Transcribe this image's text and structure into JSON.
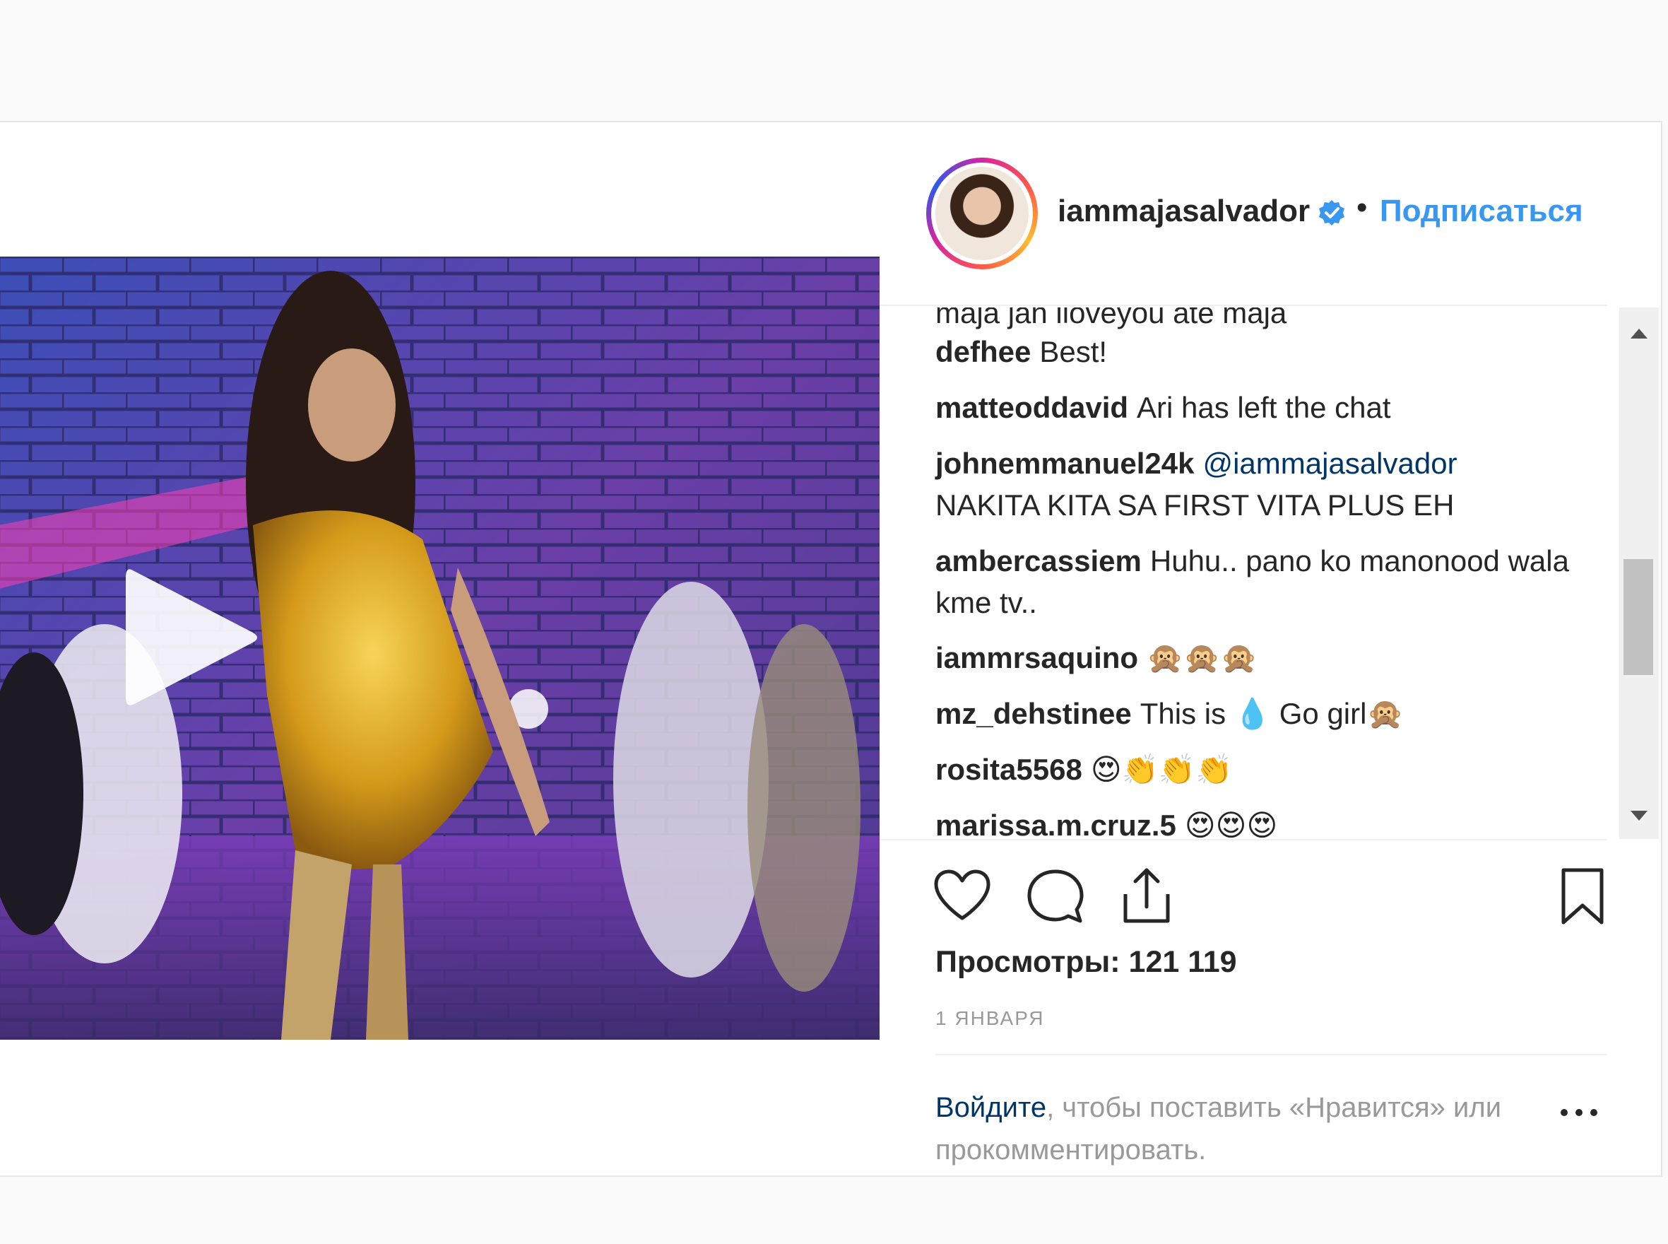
{
  "post": {
    "username": "iammajasalvador",
    "verified_icon": "verified-badge-icon",
    "separator": "•",
    "follow_label": "Подписаться",
    "comments": [
      {
        "user": "",
        "text": "maja jan iloveyou ate maja"
      },
      {
        "user": "defhee",
        "text": "Best!"
      },
      {
        "user": "matteoddavid",
        "text": "Ari has left the chat"
      },
      {
        "user": "johnemmanuel24k",
        "mention": "@iammajasalvador",
        "text": "NAKITA KITA SA FIRST VITA PLUS EH"
      },
      {
        "user": "ambercassiem",
        "text": "Huhu.. pano ko manonood wala kme tv.."
      },
      {
        "user": "iammrsaquino",
        "text": "🙊🙊🙊"
      },
      {
        "user": "mz_dehstinee",
        "text": "This is 💧 Go girl🙊"
      },
      {
        "user": "rosita5568",
        "text": "😍👏👏👏"
      },
      {
        "user": "marissa.m.cruz.5",
        "text": "😍😍😍"
      }
    ],
    "views": "Просмотры: 121 119",
    "date": "1 ЯНВАРЯ",
    "login_link": "Войдите",
    "login_rest": ", чтобы поставить «Нравится» или прокомментировать.",
    "more_icon": "more-options-icon"
  },
  "colors": {
    "link": "#3897f0",
    "text": "#262626",
    "muted": "#999999",
    "mention": "#003569"
  }
}
